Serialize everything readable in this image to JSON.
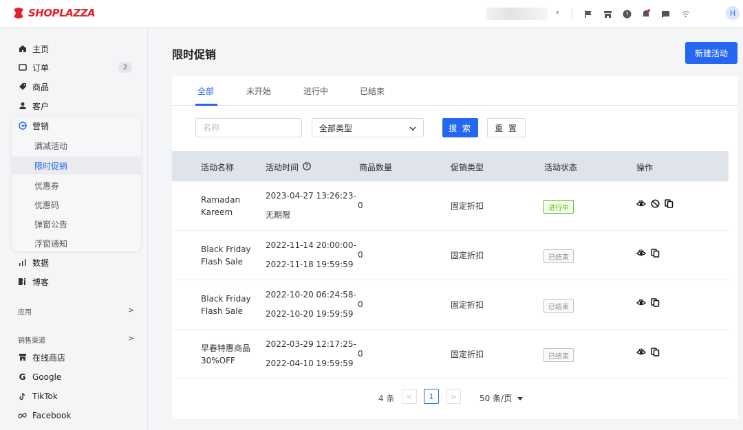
{
  "brand": {
    "name": "SHOPLAZZA",
    "color": "#e5202e"
  },
  "topbar": {
    "store_caret": "▾",
    "icons": [
      "flag-icon",
      "store-icon",
      "help-icon",
      "notification-icon",
      "message-icon",
      "wifi-icon"
    ],
    "avatar_initial": "H"
  },
  "sidebar": {
    "home": "主页",
    "orders": "订单",
    "orders_count": "2",
    "products": "商品",
    "customers": "客户",
    "marketing": "营销",
    "marketing_sub": [
      "满减活动",
      "限时促销",
      "优惠券",
      "优惠码",
      "弹窗公告",
      "浮窗通知"
    ],
    "data": "数据",
    "blog": "博客",
    "apps_section": "应用",
    "sales_channels_section": "销售渠道",
    "online_store": "在线商店",
    "google": "Google",
    "tiktok": "TikTok",
    "facebook": "Facebook",
    "active_sub_index": 1
  },
  "main": {
    "title": "限时促销",
    "create_button": "新建活动",
    "tabs": [
      "全部",
      "未开始",
      "进行中",
      "已结束"
    ],
    "active_tab": 0,
    "filters": {
      "name_placeholder": "名称",
      "type_value": "全部类型",
      "search_label": "搜 索",
      "reset_label": "重 置"
    },
    "table": {
      "headers": [
        "活动名称",
        "活动时间",
        "商品数量",
        "促销类型",
        "活动状态",
        "操作"
      ],
      "rows": [
        {
          "name_line1": "Ramadan",
          "name_line2": "Kareem",
          "time_start": "2023-04-27 13:26:23-",
          "time_end": "无期限",
          "count": "0",
          "type": "固定折扣",
          "status": "进行中",
          "status_kind": "on",
          "actions": [
            "view-icon",
            "disable-icon",
            "copy-icon"
          ]
        },
        {
          "name_line1": "Black Friday",
          "name_line2": "Flash Sale",
          "time_start": "2022-11-14 20:00:00-",
          "time_end": "2022-11-18 19:59:59",
          "count": "0",
          "type": "固定折扣",
          "status": "已结束",
          "status_kind": "off",
          "actions": [
            "view-icon",
            "copy-icon"
          ]
        },
        {
          "name_line1": "Black Friday",
          "name_line2": "Flash Sale",
          "time_start": "2022-10-20 06:24:58-",
          "time_end": "2022-10-20 19:59:59",
          "count": "0",
          "type": "固定折扣",
          "status": "已结束",
          "status_kind": "off",
          "actions": [
            "view-icon",
            "copy-icon"
          ]
        },
        {
          "name_line1": "早春特惠商品",
          "name_line2": "30%OFF",
          "time_start": "2022-03-29 12:17:25-",
          "time_end": "2022-04-10 19:59:59",
          "count": "0",
          "type": "固定折扣",
          "status": "已结束",
          "status_kind": "off",
          "actions": [
            "view-icon",
            "copy-icon"
          ]
        }
      ]
    },
    "pagination": {
      "total": "4 条",
      "current_page": "1",
      "page_size": "50 条/页"
    }
  },
  "colors": {
    "primary": "#2468f2",
    "success": "#52c41a"
  }
}
